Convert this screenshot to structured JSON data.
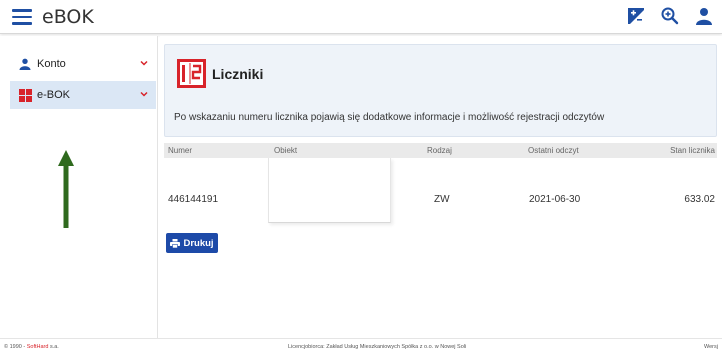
{
  "app": {
    "title": "eBOK"
  },
  "sidebar": {
    "items": [
      {
        "label": "Konto",
        "icon": "user-icon"
      },
      {
        "label": "e-BOK",
        "icon": "ebok-grid-icon"
      }
    ]
  },
  "main": {
    "card": {
      "title": "Liczniki",
      "description": "Po wskazaniu numeru licznika pojawią się dodatkowe informacje i możliwość rejestracji odczytów"
    },
    "table": {
      "columns": [
        "Numer",
        "Obiekt",
        "Rodzaj",
        "Ostatni odczyt",
        "Stan licznika"
      ],
      "rows": [
        {
          "numer": "446144191",
          "obiekt": "",
          "rodzaj": "ZW",
          "ostatni_odczyt": "2021-06-30",
          "stan_licznika": "633.02"
        }
      ]
    },
    "print_label": "Drukuj"
  },
  "footer": {
    "copyright_prefix": "© 1990 - ",
    "brand": "SoftHard",
    "brand_suffix": " s.a.",
    "license": "Licencjobiorca: Zakład Usług Mieszkaniowych Spółka z o.o. w Nowej Soli",
    "version": "Wersj"
  },
  "colors": {
    "accent": "#1d4aa8",
    "brand_red": "#d8232a",
    "arrow_green": "#2f6a1e",
    "selected_bg": "#dbe7f5"
  }
}
